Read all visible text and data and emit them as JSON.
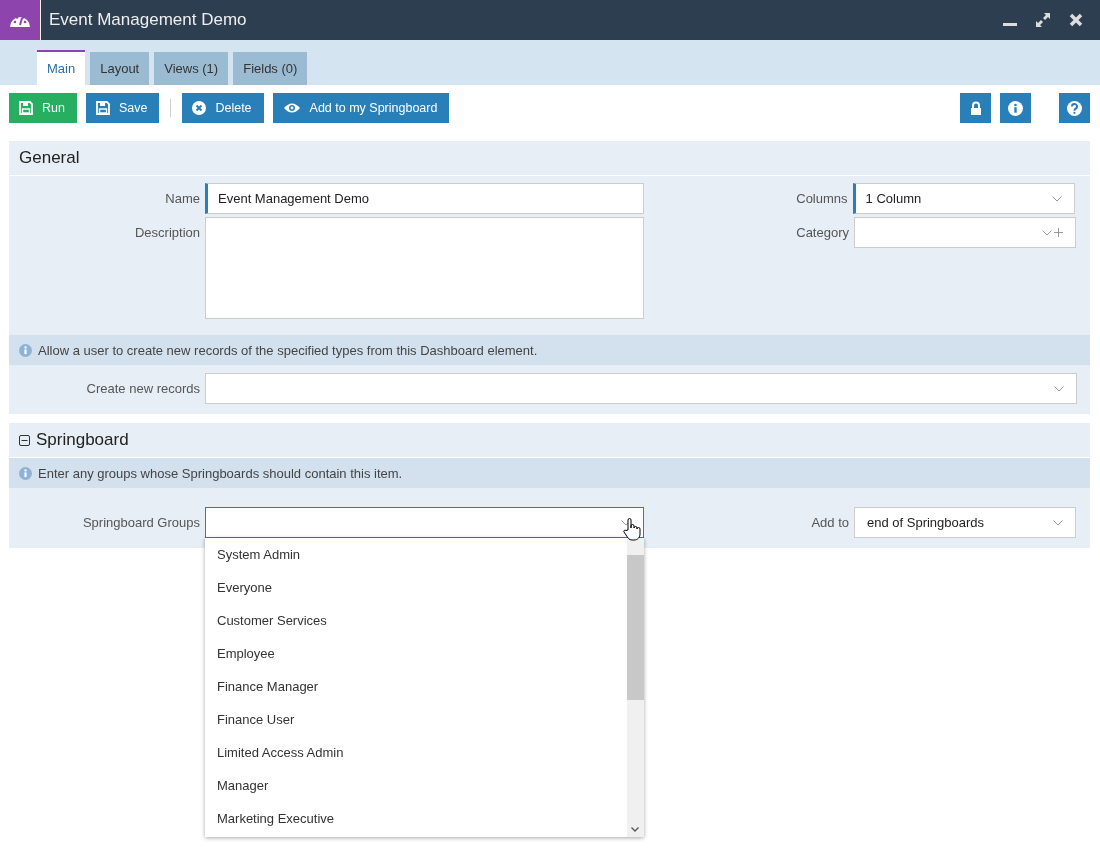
{
  "window": {
    "title": "Event Management Demo"
  },
  "tabs": [
    {
      "label": "Main",
      "selected": true
    },
    {
      "label": "Layout",
      "selected": false
    },
    {
      "label": "Views (1)",
      "selected": false
    },
    {
      "label": "Fields (0)",
      "selected": false
    }
  ],
  "toolbar": {
    "buttons": [
      {
        "label": "Run",
        "kind": "save",
        "color": "#27ae60"
      },
      {
        "label": "Save",
        "kind": "save",
        "color": "#2980b9"
      },
      {
        "label": "Delete",
        "kind": "delete",
        "color": "#2980b9"
      },
      {
        "label": "Add to my Springboard",
        "kind": "view",
        "color": "#2980b9"
      }
    ],
    "icon_buttons": [
      {
        "kind": "lock"
      },
      {
        "kind": "info"
      },
      {
        "kind": "help"
      }
    ]
  },
  "sections": [
    {
      "title": "General",
      "blocks": [
        {
          "kind": "grid",
          "left": [
            {
              "label": "Name",
              "kind": "text",
              "value": "Event Management Demo",
              "required": true,
              "focused": false
            },
            {
              "label": "Description",
              "kind": "textarea",
              "required": false,
              "focused": false
            }
          ],
          "right": [
            {
              "label": "Columns",
              "kind": "select",
              "value": "1 Column",
              "required": true,
              "focused": false
            },
            {
              "label": "Category",
              "kind": "select-add",
              "required": false,
              "focused": false
            }
          ]
        },
        {
          "kind": "info",
          "text": "Allow a user to create new records of the specified types from this Dashboard element."
        },
        {
          "kind": "wide",
          "field": {
            "label": "Create new records",
            "kind": "select",
            "required": false,
            "focused": false
          }
        }
      ]
    },
    {
      "title": "Springboard",
      "expanded": true,
      "blocks": [
        {
          "kind": "info",
          "text": "Enter any groups whose Springboards should contain this item."
        },
        {
          "kind": "grid",
          "left": [
            {
              "label": "Springboard Groups",
              "kind": "select",
              "required": false,
              "focused": true,
              "open": true,
              "options": [
                "System Admin",
                "Everyone",
                "Customer Services",
                "Employee",
                "Finance Manager",
                "Finance User",
                "Limited Access Admin",
                "Manager",
                "Marketing Executive"
              ]
            }
          ],
          "right": [
            {
              "label": "Add to",
              "kind": "select",
              "value": "end of Springboards",
              "required": false,
              "focused": false
            }
          ]
        }
      ]
    }
  ]
}
